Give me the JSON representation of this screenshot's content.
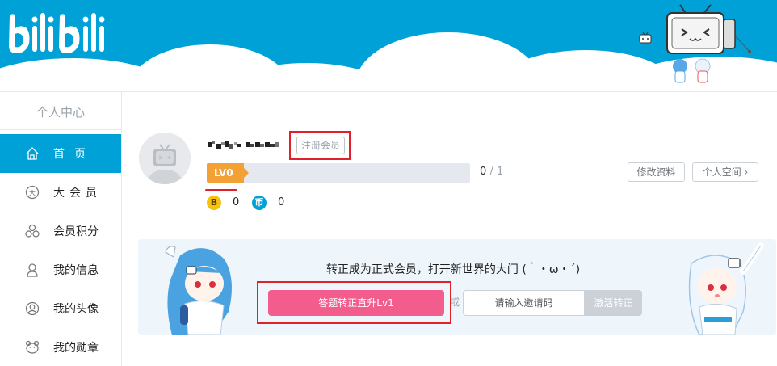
{
  "header": {
    "logo_text": "bilibili"
  },
  "sidebar": {
    "title": "个人中心",
    "items": [
      {
        "label": "首页",
        "icon": "home-icon",
        "active": true
      },
      {
        "label": "大会员",
        "icon": "vip-icon",
        "active": false
      },
      {
        "label": "会员积分",
        "icon": "points-icon",
        "active": false
      },
      {
        "label": "我的信息",
        "icon": "user-icon",
        "active": false
      },
      {
        "label": "我的头像",
        "icon": "avatar-icon",
        "active": false
      },
      {
        "label": "我的勋章",
        "icon": "medal-icon",
        "active": false
      }
    ]
  },
  "profile": {
    "member_badge": "注册会员",
    "level_label": "LV0",
    "level_current": "0",
    "level_separator": "/",
    "level_max": "1",
    "bcoin_symbol": "B",
    "bcoin_value": "0",
    "coin_symbol": "币",
    "coin_value": "0",
    "edit_button": "修改资料",
    "space_button": "个人空间 ›"
  },
  "banner": {
    "message": "转正成为正式会员，打开新世界的大门 (｀・ω・´)",
    "answer_button": "答题转正直升Lv1",
    "or_text": "或",
    "invite_placeholder": "请输入邀请码",
    "activate_button": "激活转正"
  },
  "colors": {
    "brand_blue": "#00a1d6",
    "brand_pink": "#f25d8e",
    "level_orange": "#f3a034",
    "highlight_red": "#e0202b"
  }
}
